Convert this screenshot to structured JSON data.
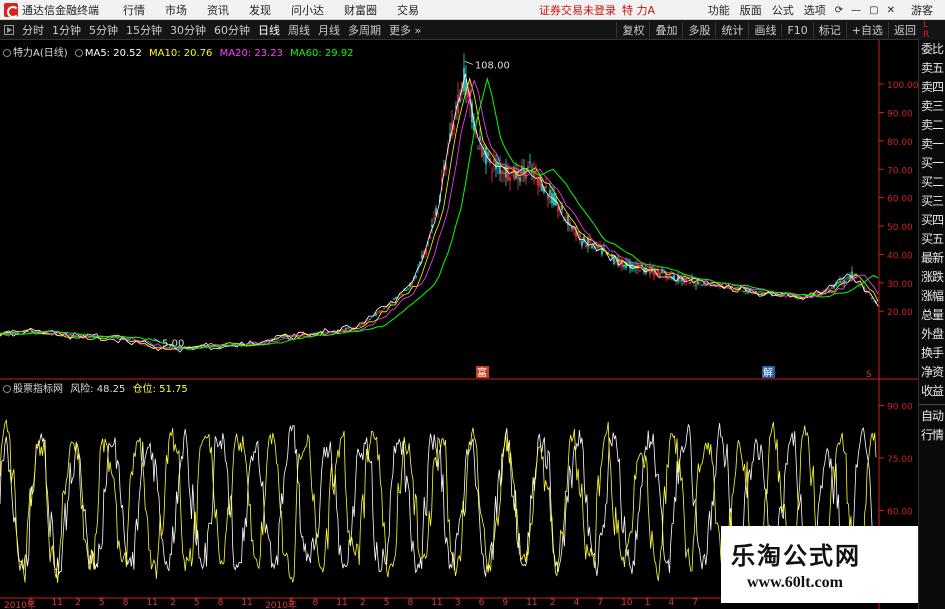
{
  "titlebar": {
    "app_name": "通达信金融终端",
    "menus": [
      "行情",
      "市场",
      "资讯",
      "发现",
      "问小达",
      "财富圈",
      "交易"
    ],
    "login_status": "证券交易未登录",
    "stock_title": "特 力A",
    "right_items": [
      "功能",
      "版面",
      "公式",
      "选项"
    ],
    "guest": "游客"
  },
  "toolbar": {
    "periods": [
      "分时",
      "1分钟",
      "5分钟",
      "15分钟",
      "30分钟",
      "60分钟",
      "日线",
      "周线",
      "月线",
      "多周期",
      "更多"
    ],
    "active_period": "日线",
    "right_items": [
      "复权",
      "叠加",
      "多股",
      "统计",
      "画线",
      "F10",
      "标记",
      "+自选",
      "返回"
    ]
  },
  "sidebar": {
    "corner": "L",
    "corner_sub": "R",
    "items_top": [
      "委比",
      "卖五",
      "卖四",
      "卖三",
      "卖二",
      "卖一",
      "买一",
      "买二",
      "买三",
      "买四",
      "买五",
      "最新",
      "涨跌",
      "涨幅",
      "总量",
      "外盘",
      "换手",
      "净资",
      "收益"
    ],
    "items_bottom": [
      "自动",
      "行情"
    ]
  },
  "k_legend": {
    "title": "特力A(日线)",
    "ma5": "MA5: 20.52",
    "ma10": "MA10: 20.76",
    "ma20": "MA20: 23.23",
    "ma60": "MA60: 29.92"
  },
  "ind_legend": {
    "title": "股票指标网",
    "risk": "风险: 48.25",
    "position": "仓位: 51.75"
  },
  "annotations": {
    "high": "108.00",
    "low": "5.00",
    "mark1": "富",
    "mark2": "解",
    "mark3": "S"
  },
  "xaxis": {
    "labels": [
      "2010年",
      "8",
      "11",
      "2",
      "5",
      "8",
      "11",
      "2",
      "5",
      "8",
      "11",
      "2010年",
      "5",
      "8",
      "11",
      "2",
      "5",
      "8",
      "11",
      "3",
      "6",
      "9",
      "11",
      "2",
      "4",
      "7",
      "10",
      "1",
      "4",
      "7"
    ]
  },
  "watermark": {
    "name": "乐淘公式网",
    "url": "www.60lt.com"
  },
  "colors": {
    "ma5": "#ffffff",
    "ma10": "#ffff00",
    "ma20": "#ff44ff",
    "ma60": "#00ff00",
    "axis_red": "#d02020",
    "risk_line": "#ffffff",
    "position_line": "#ffff33"
  },
  "chart_data": [
    {
      "type": "line",
      "title": "特力A(日线)",
      "ylim": [
        0,
        112
      ],
      "yticks": [
        20.0,
        30.0,
        40.0,
        50.0,
        60.0,
        70.0,
        80.0,
        90.0,
        100.0
      ],
      "ytick_labels": [
        "20.00",
        "30.00",
        "40.00",
        "50.00",
        "60.00",
        "70.00",
        "80.00",
        "90.00",
        "100.00"
      ],
      "x": [
        0,
        10,
        20,
        30,
        40,
        50,
        60,
        70,
        80,
        90,
        100,
        110,
        120,
        130,
        140,
        150,
        160,
        165,
        170,
        175,
        180,
        185,
        190,
        195,
        200,
        205,
        210,
        215,
        220,
        225,
        230,
        235,
        240,
        250,
        260,
        270,
        280,
        290,
        300,
        310,
        320,
        330,
        340
      ],
      "close": [
        12,
        13,
        12,
        11,
        11,
        10,
        7,
        7,
        8,
        8,
        9,
        11,
        12,
        13,
        15,
        22,
        30,
        42,
        58,
        85,
        103,
        80,
        72,
        70,
        68,
        70,
        65,
        58,
        52,
        45,
        43,
        40,
        37,
        35,
        32,
        30,
        29,
        27,
        26,
        25,
        27,
        33,
        22
      ],
      "series": [
        {
          "name": "MA5",
          "value": 20.52
        },
        {
          "name": "MA10",
          "value": 20.76
        },
        {
          "name": "MA20",
          "value": 23.23
        },
        {
          "name": "MA60",
          "value": 29.92
        }
      ],
      "high_label": 108.0,
      "low_label": 5.0
    },
    {
      "type": "line",
      "title": "股票指标网",
      "ylim": [
        35,
        95
      ],
      "yticks": [
        45.0,
        60.0,
        75.0,
        90.0
      ],
      "ytick_labels": [
        "45.00",
        "60.00",
        "75.00",
        "90.00"
      ],
      "series": [
        {
          "name": "风险",
          "last": 48.25
        },
        {
          "name": "仓位",
          "last": 51.75
        }
      ]
    }
  ]
}
